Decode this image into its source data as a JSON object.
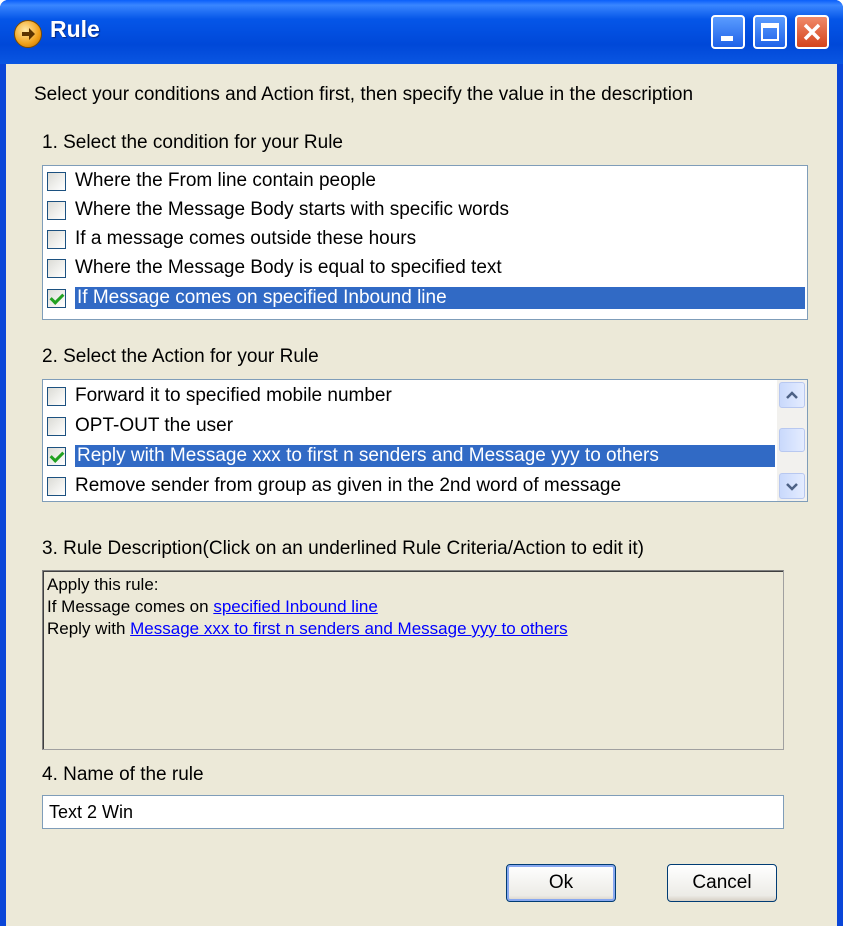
{
  "window": {
    "title": "Rule"
  },
  "instruction": "Select your conditions and Action first, then specify the value in the description",
  "conditions": {
    "heading": "1. Select the condition for your Rule",
    "items": [
      {
        "label": "Where the From line contain people",
        "checked": false,
        "selected": false
      },
      {
        "label": "Where the Message Body starts with specific words",
        "checked": false,
        "selected": false
      },
      {
        "label": "If a message comes outside  these hours",
        "checked": false,
        "selected": false
      },
      {
        "label": "Where the Message Body is equal to specified text",
        "checked": false,
        "selected": false
      },
      {
        "label": "If Message comes on specified Inbound line",
        "checked": true,
        "selected": true
      }
    ]
  },
  "actions": {
    "heading": "2. Select the Action for your Rule",
    "items": [
      {
        "label": "Forward it to specified mobile number",
        "checked": false,
        "selected": false
      },
      {
        "label": "OPT-OUT the user",
        "checked": false,
        "selected": false
      },
      {
        "label": "Reply with Message xxx to first n senders and Message yyy to others",
        "checked": true,
        "selected": true
      },
      {
        "label": "Remove sender from group as given in the 2nd word of message",
        "checked": false,
        "selected": false
      }
    ]
  },
  "description": {
    "heading": "3. Rule Description(Click on an underlined Rule Criteria/Action to edit it)",
    "line1": "Apply this rule:",
    "line2_prefix": "If Message comes on ",
    "line2_link": "specified Inbound line",
    "line3_prefix": "Reply with ",
    "line3_link": "Message xxx to first n senders and Message yyy to others"
  },
  "name": {
    "heading": "4. Name of the rule",
    "value": "Text 2 Win"
  },
  "buttons": {
    "ok": "Ok",
    "cancel": "Cancel"
  },
  "colors": {
    "selection": "#316ac5",
    "link": "#0000ff",
    "titlebar": "#0048d8"
  }
}
